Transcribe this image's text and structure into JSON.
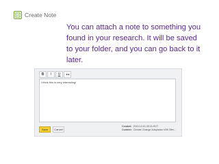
{
  "header": {
    "title": "Create Note",
    "icon": "note-icon"
  },
  "caption": "You can attach a note to something you found in your research. It will be saved to your folder, and you can go back to it later.",
  "editor": {
    "toolbar": [
      {
        "name": "bold-button",
        "label": "B"
      },
      {
        "name": "italic-button",
        "label": "I"
      },
      {
        "name": "underline-button",
        "label": "U"
      },
      {
        "name": "link-button",
        "icon": "link-icon"
      }
    ],
    "text": "I think this is very interesting!",
    "save_label": "Save",
    "cancel_label": "Cancel",
    "meta": {
      "created_label": "Created:",
      "created_value": "2015-10-01 09:31 EDT",
      "content_label": "Content:",
      "content_value": "Climate Change Adaptation Will Offer..."
    }
  },
  "colors": {
    "caption": "#5a2a86",
    "save_button": "#f5cd37",
    "panel": "#eef0f2"
  }
}
